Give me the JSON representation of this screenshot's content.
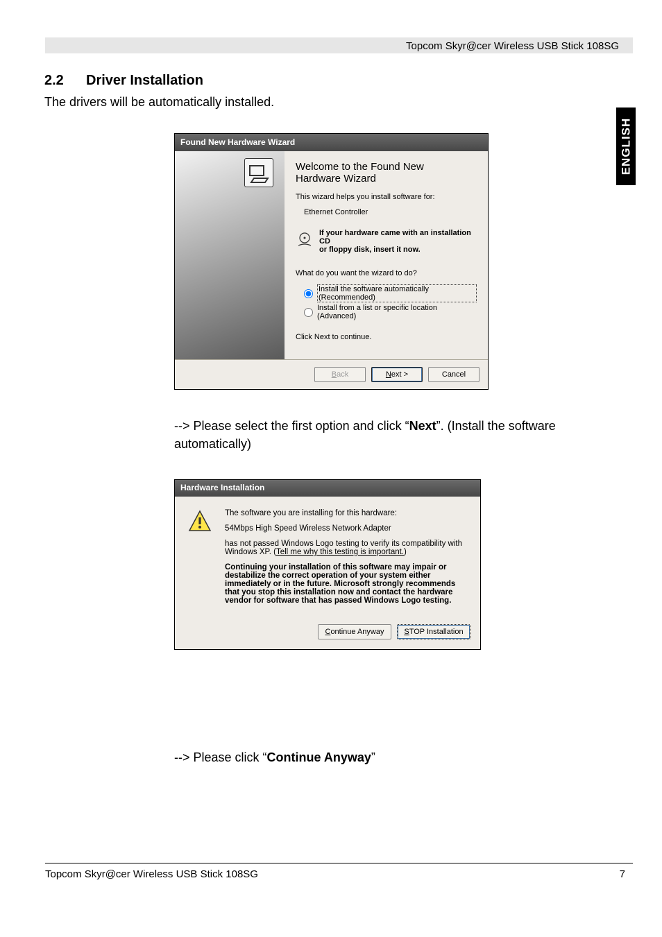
{
  "header": {
    "product": "Topcom Skyr@cer Wireless USB Stick 108SG"
  },
  "section": {
    "number": "2.2",
    "title": "Driver Installation",
    "intro": "The drivers will be automatically installed."
  },
  "side_tab": "ENGLISH",
  "wizard": {
    "title": "Found New Hardware Wizard",
    "welcome_l1": "Welcome to the Found New",
    "welcome_l2": "Hardware Wizard",
    "helps": "This wizard helps you install software for:",
    "device": "Ethernet Controller",
    "cd_hint_l1": "If your hardware came with an installation CD",
    "cd_hint_l2": "or floppy disk, insert it now.",
    "what_do": "What do you want the wizard to do?",
    "opt1": "Install the software automatically (Recommended)",
    "opt2": "Install from a list or specific location (Advanced)",
    "click_next": "Click Next to continue.",
    "back": "< Back",
    "next": "Next >",
    "cancel": "Cancel"
  },
  "caption1": {
    "pre": "--> Please select the first option and click “",
    "bold": "Next",
    "post": "”. (Install the software automatically)"
  },
  "dialog": {
    "title": "Hardware Installation",
    "line1": "The software you are installing for this hardware:",
    "device": "54Mbps High Speed Wireless Network Adapter",
    "line2a": "has not passed Windows Logo testing to verify its compatibility with Windows XP. (",
    "link": "Tell me why this testing is important.",
    "line2b": ")",
    "bold_para": "Continuing your installation of this software may impair or destabilize the correct operation of your system either immediately or in the future. Microsoft strongly recommends that you stop this installation now and contact the hardware vendor for software that has passed Windows Logo testing.",
    "continue": "Continue Anyway",
    "stop": "STOP Installation"
  },
  "caption2": {
    "pre": "--> Please click “",
    "bold": "Continue Anyway",
    "post": "”"
  },
  "footer": {
    "left": "Topcom Skyr@cer Wireless USB Stick 108SG",
    "page": "7"
  }
}
